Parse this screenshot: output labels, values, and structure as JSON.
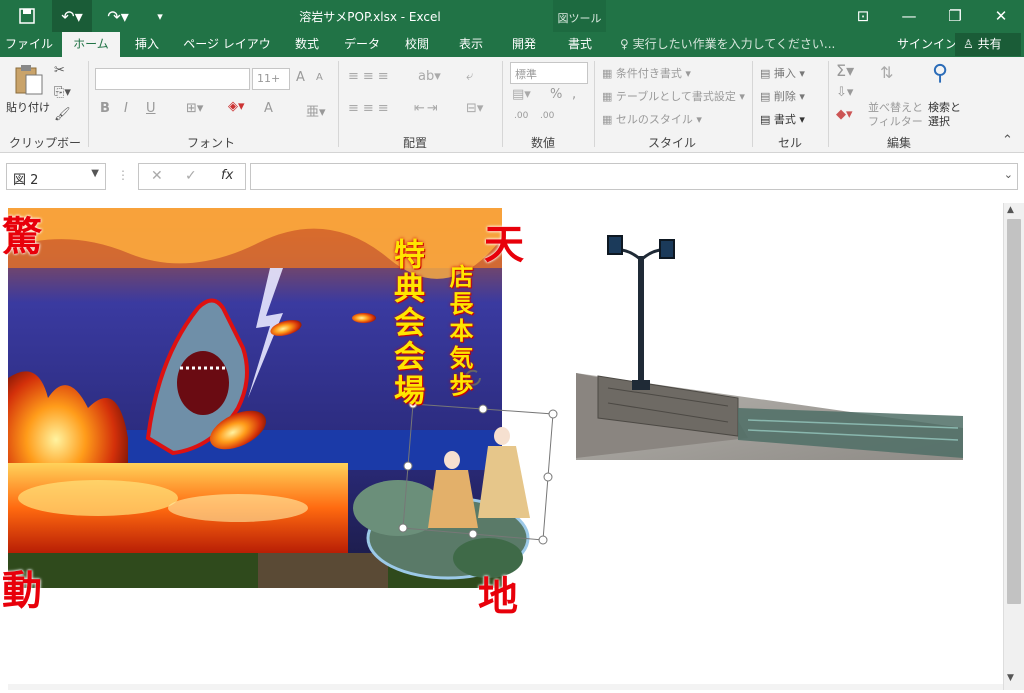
{
  "window": {
    "title": "溶岩サメPOP.xlsx - Excel",
    "context_tool": "図ツール"
  },
  "tabs": [
    "ファイル",
    "ホーム",
    "挿入",
    "ページ レイアウト",
    "数式",
    "データ",
    "校閲",
    "表示",
    "開発",
    "書式"
  ],
  "tell_me": "実行したい作業を入力してください...",
  "signin": "サインイン",
  "share": "共有",
  "ribbon": {
    "clipboard": {
      "label": "クリップボード",
      "paste": "貼り付け"
    },
    "font": {
      "label": "フォント",
      "size": "11+",
      "bold": "B",
      "italic": "I",
      "underline": "U",
      "grow": "A",
      "shrink": "A",
      "color_a": "A"
    },
    "alignment": {
      "label": "配置"
    },
    "number": {
      "label": "数値",
      "format": "標準",
      "percent": "%",
      "comma": ",",
      "dec_inc": ".00",
      "dec_dec": ".00"
    },
    "styles": {
      "label": "スタイル",
      "conditional": "条件付き書式",
      "table": "テーブルとして書式設定",
      "cell_styles": "セルのスタイル"
    },
    "cells": {
      "label": "セル",
      "insert": "挿入",
      "delete": "削除",
      "format": "書式"
    },
    "editing": {
      "label": "編集",
      "sort": "並べ替えと",
      "sort2": "フィルター",
      "find": "検索と",
      "find2": "選択"
    }
  },
  "formula_bar": {
    "name_box": "図 2",
    "fx": "fx",
    "value": ""
  },
  "poster": {
    "corner_tl": "驚",
    "corner_tr": "天",
    "corner_bl": "動",
    "corner_br": "地",
    "main_text": "特典会会場",
    "sub_text": "店長本気歩"
  },
  "colors": {
    "excel_green": "#217346",
    "ribbon_bg": "#f3f3f3"
  }
}
